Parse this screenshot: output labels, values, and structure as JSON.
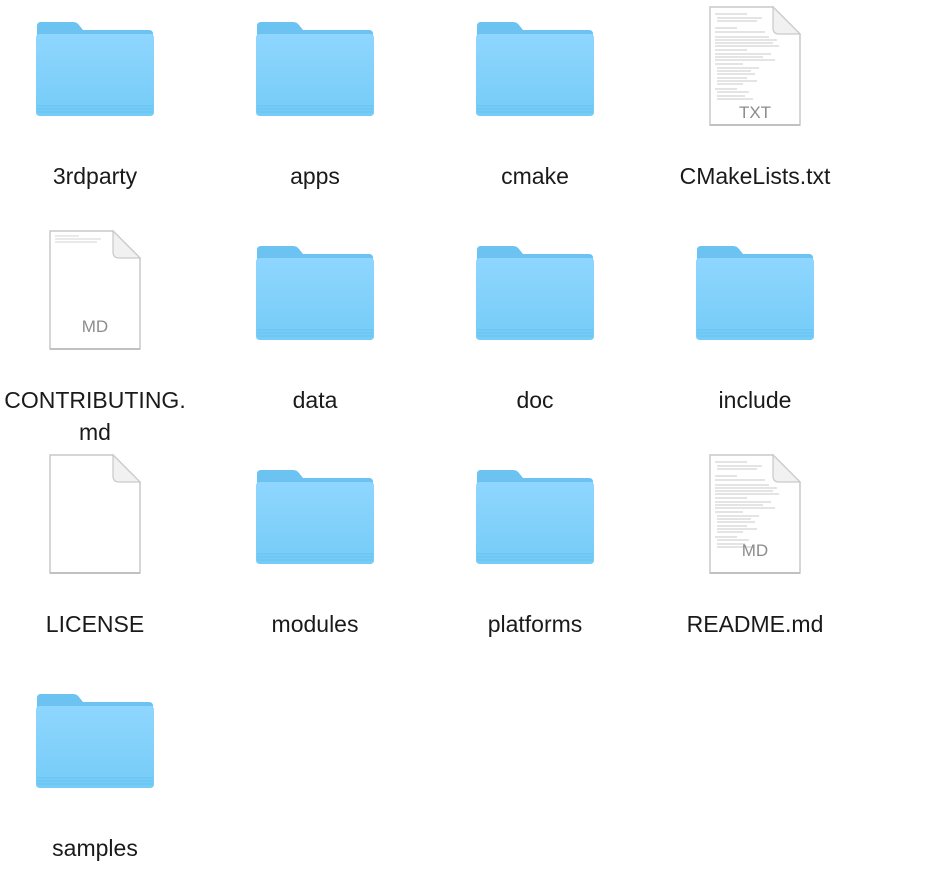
{
  "colors": {
    "folder_top": "#8fd6ff",
    "folder_body": "#76cdf8",
    "folder_tab": "#6cc3f1",
    "folder_edge": "#5bb6e8",
    "document_fill": "#ffffff",
    "document_border": "#c8c8c8",
    "label_text": "#1a1a1a"
  },
  "items": [
    {
      "name": "3rdparty",
      "kind": "folder",
      "icon": "folder-icon"
    },
    {
      "name": "apps",
      "kind": "folder",
      "icon": "folder-icon"
    },
    {
      "name": "cmake",
      "kind": "folder",
      "icon": "folder-icon"
    },
    {
      "name": "CMakeLists.txt",
      "kind": "document",
      "icon": "text-document-icon",
      "badge": "TXT"
    },
    {
      "name_line1": "CONTRIBUTING.",
      "name_line2": "md",
      "kind": "document",
      "icon": "markdown-document-icon",
      "badge": "MD"
    },
    {
      "name": "data",
      "kind": "folder",
      "icon": "folder-icon"
    },
    {
      "name": "doc",
      "kind": "folder",
      "icon": "folder-icon"
    },
    {
      "name": "include",
      "kind": "folder",
      "icon": "folder-icon"
    },
    {
      "name": "LICENSE",
      "kind": "document",
      "icon": "blank-document-icon",
      "badge": ""
    },
    {
      "name": "modules",
      "kind": "folder",
      "icon": "folder-icon"
    },
    {
      "name": "platforms",
      "kind": "folder",
      "icon": "folder-icon"
    },
    {
      "name": "README.md",
      "kind": "document",
      "icon": "markdown-document-icon",
      "badge": "MD"
    },
    {
      "name": "samples",
      "kind": "folder",
      "icon": "folder-icon"
    }
  ]
}
